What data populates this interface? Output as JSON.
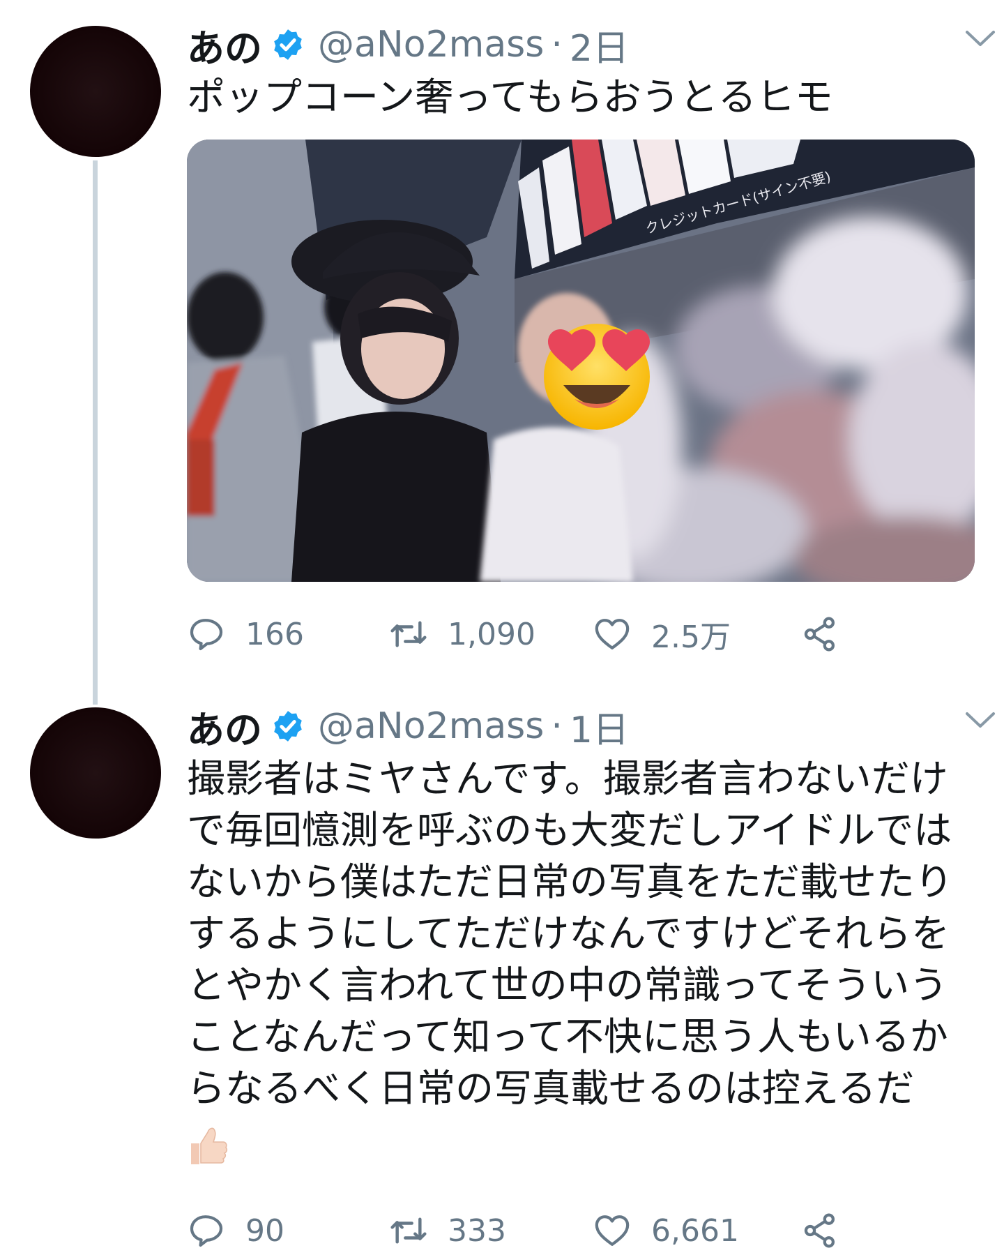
{
  "tweets": [
    {
      "display_name": "あの",
      "handle": "@aNo2mass",
      "separator": "·",
      "time": "2日",
      "text": "ポップコーン奢ってもらおうとるヒモ",
      "media": {
        "signage": "クレジットカード(サイン不要)"
      },
      "reply_count": "166",
      "retweet_count": "1,090",
      "like_count": "2.5万"
    },
    {
      "display_name": "あの",
      "handle": "@aNo2mass",
      "separator": "·",
      "time": "1日",
      "text_lines": [
        "撮影者はミヤさんです。撮影者言わないだけ",
        "で毎回憶測を呼ぶのも大変だしアイドルでは",
        "ないから僕はただ日常の写真をただ載せたり",
        "するようにしてただけなんですけどそれらを",
        "とやかく言われて世の中の常識ってそういう",
        "ことなんだって知って不快に思う人もいるか",
        "らなるべく日常の写真載せるのは控えるだ"
      ],
      "reply_count": "90",
      "retweet_count": "333",
      "like_count": "6,661"
    }
  ],
  "icons": {
    "verified": "verified-badge-icon",
    "menu": "chevron-down-icon",
    "reply": "reply-icon",
    "retweet": "retweet-icon",
    "like": "heart-icon",
    "share": "share-icon",
    "emoji": "thumbs-up-emoji"
  },
  "colors": {
    "verified_blue": "#1da1f2",
    "secondary_text": "#657786",
    "primary_text": "#14171a",
    "thread_line": "#c9d4dc"
  }
}
